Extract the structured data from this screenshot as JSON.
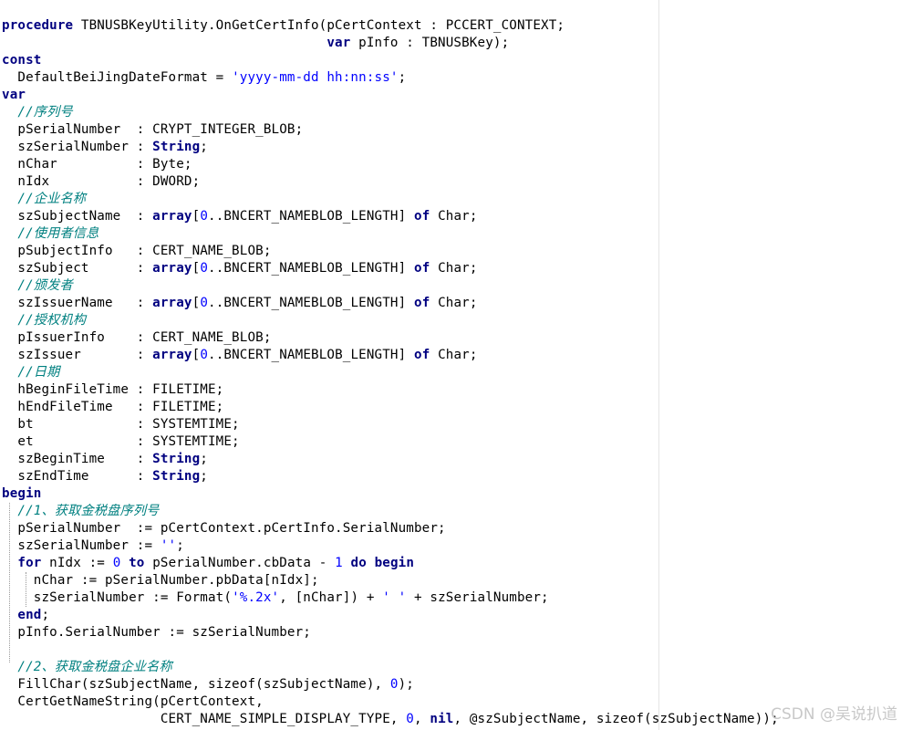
{
  "editor": {
    "lines": [
      [
        {
          "t": "procedure",
          "c": "kw"
        },
        {
          "t": " TBNUSBKeyUtility.OnGetCertInfo(pCertContext : PCCERT_CONTEXT;"
        }
      ],
      [
        {
          "t": "                                         "
        },
        {
          "t": "var",
          "c": "kw"
        },
        {
          "t": " pInfo : TBNUSBKey);"
        }
      ],
      [
        {
          "t": "const",
          "c": "kw"
        }
      ],
      [
        {
          "t": "  DefaultBeiJingDateFormat = "
        },
        {
          "t": "'yyyy-mm-dd hh:nn:ss'",
          "c": "str"
        },
        {
          "t": ";"
        }
      ],
      [
        {
          "t": "var",
          "c": "kw"
        }
      ],
      [
        {
          "t": "  //序列号",
          "c": "cmt"
        }
      ],
      [
        {
          "t": "  pSerialNumber  : CRYPT_INTEGER_BLOB;"
        }
      ],
      [
        {
          "t": "  szSerialNumber : "
        },
        {
          "t": "String",
          "c": "kw"
        },
        {
          "t": ";"
        }
      ],
      [
        {
          "t": "  nChar          : Byte;"
        }
      ],
      [
        {
          "t": "  nIdx           : DWORD;"
        }
      ],
      [
        {
          "t": "  //企业名称",
          "c": "cmt"
        }
      ],
      [
        {
          "t": "  szSubjectName  : "
        },
        {
          "t": "array",
          "c": "kw"
        },
        {
          "t": "["
        },
        {
          "t": "0",
          "c": "num"
        },
        {
          "t": "..BNCERT_NAMEBLOB_LENGTH] "
        },
        {
          "t": "of",
          "c": "kw"
        },
        {
          "t": " Char;"
        }
      ],
      [
        {
          "t": "  //使用者信息",
          "c": "cmt"
        }
      ],
      [
        {
          "t": "  pSubjectInfo   : CERT_NAME_BLOB;"
        }
      ],
      [
        {
          "t": "  szSubject      : "
        },
        {
          "t": "array",
          "c": "kw"
        },
        {
          "t": "["
        },
        {
          "t": "0",
          "c": "num"
        },
        {
          "t": "..BNCERT_NAMEBLOB_LENGTH] "
        },
        {
          "t": "of",
          "c": "kw"
        },
        {
          "t": " Char;"
        }
      ],
      [
        {
          "t": "  //颁发者",
          "c": "cmt"
        }
      ],
      [
        {
          "t": "  szIssuerName   : "
        },
        {
          "t": "array",
          "c": "kw"
        },
        {
          "t": "["
        },
        {
          "t": "0",
          "c": "num"
        },
        {
          "t": "..BNCERT_NAMEBLOB_LENGTH] "
        },
        {
          "t": "of",
          "c": "kw"
        },
        {
          "t": " Char;"
        }
      ],
      [
        {
          "t": "  //授权机构",
          "c": "cmt"
        }
      ],
      [
        {
          "t": "  pIssuerInfo    : CERT_NAME_BLOB;"
        }
      ],
      [
        {
          "t": "  szIssuer       : "
        },
        {
          "t": "array",
          "c": "kw"
        },
        {
          "t": "["
        },
        {
          "t": "0",
          "c": "num"
        },
        {
          "t": "..BNCERT_NAMEBLOB_LENGTH] "
        },
        {
          "t": "of",
          "c": "kw"
        },
        {
          "t": " Char;"
        }
      ],
      [
        {
          "t": "  //日期",
          "c": "cmt"
        }
      ],
      [
        {
          "t": "  hBeginFileTime : FILETIME;"
        }
      ],
      [
        {
          "t": "  hEndFileTime   : FILETIME;"
        }
      ],
      [
        {
          "t": "  bt             : SYSTEMTIME;"
        }
      ],
      [
        {
          "t": "  et             : SYSTEMTIME;"
        }
      ],
      [
        {
          "t": "  szBeginTime    : "
        },
        {
          "t": "String",
          "c": "kw"
        },
        {
          "t": ";"
        }
      ],
      [
        {
          "t": "  szEndTime      : "
        },
        {
          "t": "String",
          "c": "kw"
        },
        {
          "t": ";"
        }
      ],
      [
        {
          "t": "begin",
          "c": "kw"
        }
      ],
      [
        {
          "t": "  //1、获取金税盘序列号",
          "c": "cmt"
        }
      ],
      [
        {
          "t": "  pSerialNumber  := pCertContext.pCertInfo.SerialNumber;"
        }
      ],
      [
        {
          "t": "  szSerialNumber := "
        },
        {
          "t": "''",
          "c": "str"
        },
        {
          "t": ";"
        }
      ],
      [
        {
          "t": "  "
        },
        {
          "t": "for",
          "c": "kw"
        },
        {
          "t": " nIdx := "
        },
        {
          "t": "0",
          "c": "num"
        },
        {
          "t": " "
        },
        {
          "t": "to",
          "c": "kw"
        },
        {
          "t": " pSerialNumber.cbData - "
        },
        {
          "t": "1",
          "c": "num"
        },
        {
          "t": " "
        },
        {
          "t": "do",
          "c": "kw"
        },
        {
          "t": " "
        },
        {
          "t": "begin",
          "c": "kw"
        }
      ],
      [
        {
          "t": "    nChar := pSerialNumber.pbData[nIdx];"
        }
      ],
      [
        {
          "t": "    szSerialNumber := Format("
        },
        {
          "t": "'%.2x'",
          "c": "str"
        },
        {
          "t": ", [nChar]) + "
        },
        {
          "t": "' '",
          "c": "str"
        },
        {
          "t": " + szSerialNumber;"
        }
      ],
      [
        {
          "t": "  "
        },
        {
          "t": "end",
          "c": "kw"
        },
        {
          "t": ";"
        }
      ],
      [
        {
          "t": "  pInfo.SerialNumber := szSerialNumber;"
        }
      ],
      [
        {
          "t": ""
        }
      ],
      [
        {
          "t": "  //2、获取金税盘企业名称",
          "c": "cmt"
        }
      ],
      [
        {
          "t": "  FillChar(szSubjectName, sizeof(szSubjectName), "
        },
        {
          "t": "0",
          "c": "num"
        },
        {
          "t": ");"
        }
      ],
      [
        {
          "t": "  CertGetNameString(pCertContext,"
        }
      ],
      [
        {
          "t": "                    CERT_NAME_SIMPLE_DISPLAY_TYPE, "
        },
        {
          "t": "0",
          "c": "num"
        },
        {
          "t": ", "
        },
        {
          "t": "nil",
          "c": "kw"
        },
        {
          "t": ", @szSubjectName, sizeof(szSubjectName));"
        }
      ]
    ]
  },
  "watermark": {
    "text": "CSDN @吴说扒道"
  },
  "colors": {
    "keyword": "#000080",
    "string": "#0000ff",
    "number": "#0000ff",
    "comment": "#008080",
    "text": "#000000"
  }
}
